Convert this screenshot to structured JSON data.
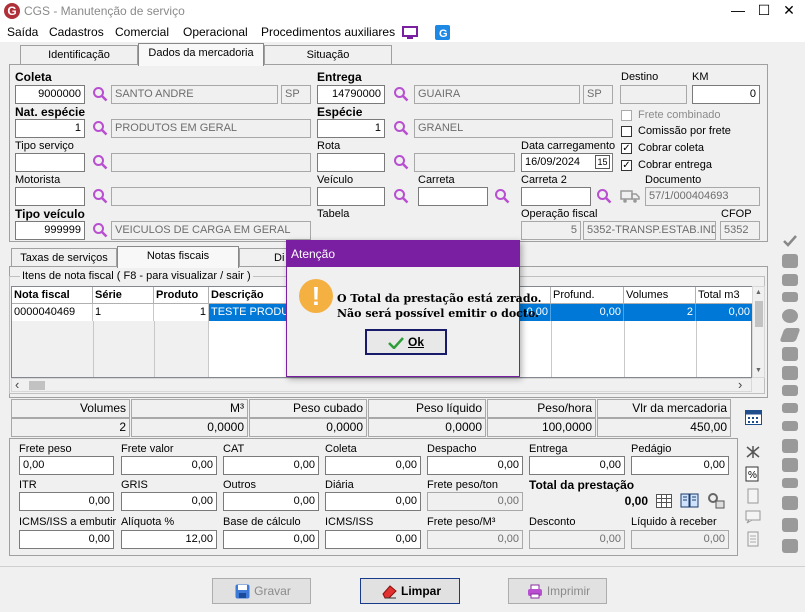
{
  "window": {
    "title": "CGS - Manutenção de serviço",
    "logo": "G",
    "minimize": "—",
    "maximize": "☐",
    "close": "✕"
  },
  "menu": [
    "Saída",
    "Cadastros",
    "Comercial",
    "Operacional",
    "Procedimentos auxiliares"
  ],
  "tabs": [
    "Identificação",
    "Dados da mercadoria",
    "Situação"
  ],
  "form": {
    "coleta": {
      "label": "Coleta",
      "code": "9000000",
      "name": "SANTO ANDRE",
      "uf": "SP"
    },
    "entrega": {
      "label": "Entrega",
      "code": "14790000",
      "name": "GUAIRA",
      "uf": "SP"
    },
    "destino": {
      "label": "Destino",
      "value": ""
    },
    "km": {
      "label": "KM",
      "value": "0"
    },
    "nat_especie": {
      "label": "Nat. espécie",
      "code": "1",
      "name": "PRODUTOS EM GERAL"
    },
    "especie": {
      "label": "Espécie",
      "code": "1",
      "name": "GRANEL"
    },
    "tipo_servico": {
      "label": "Tipo serviço"
    },
    "rota": {
      "label": "Rota"
    },
    "data_carregamento": {
      "label": "Data carregamento",
      "value": "16/09/2024",
      "day": "15"
    },
    "motorista": {
      "label": "Motorista"
    },
    "veiculo": {
      "label": "Veículo"
    },
    "carreta": {
      "label": "Carreta"
    },
    "carreta2": {
      "label": "Carreta 2"
    },
    "documento": {
      "label": "Documento",
      "value": "57/1/000404693"
    },
    "tipo_veiculo": {
      "label": "Tipo veículo",
      "code": "999999",
      "name": "VEICULOS DE CARGA EM GERAL"
    },
    "tabela": {
      "label": "Tabela"
    },
    "operacao_fiscal": {
      "label": "Operação fiscal",
      "code": "5",
      "name": "5352-TRANSP.ESTAB.IND"
    },
    "cfop": {
      "label": "CFOP",
      "value": "5352"
    },
    "checks": [
      {
        "label": "Frete combinado",
        "checked": false,
        "disabled": true
      },
      {
        "label": "Comissão por frete",
        "checked": false,
        "disabled": false
      },
      {
        "label": "Cobrar coleta",
        "checked": true,
        "disabled": false
      },
      {
        "label": "Cobrar entrega",
        "checked": true,
        "disabled": false
      }
    ]
  },
  "subtabs": [
    "Taxas de serviços",
    "Notas fiscais",
    "Di"
  ],
  "grid": {
    "title": "Itens de nota fiscal ( F8 - para visualizar / sair )",
    "headers_left": [
      "Nota fiscal",
      "Série",
      "Produto",
      "Descrição"
    ],
    "headers_right": [
      "Profund.",
      "Volumes",
      "Total m3"
    ],
    "row": {
      "nota": "0000040469",
      "serie": "1",
      "produto": "1",
      "descricao": "TESTE PRODU",
      "c1": "0,00",
      "profund": "0,00",
      "volumes": "2",
      "total_m3": "0,00"
    },
    "scroll_left": "‹",
    "scroll_right": "›",
    "scroll_up": "▲",
    "scroll_down": "▼"
  },
  "totals": {
    "labels": [
      "Volumes",
      "M³",
      "Peso cubado",
      "Peso líquido",
      "Peso/hora",
      "Vlr da mercadoria"
    ],
    "values": [
      "2",
      "0,0000",
      "0,0000",
      "0,0000",
      "100,0000",
      "450,00"
    ]
  },
  "freight": {
    "row1": [
      {
        "label": "Frete peso",
        "value": "0,00"
      },
      {
        "label": "Frete valor",
        "value": "0,00"
      },
      {
        "label": "CAT",
        "value": "0,00"
      },
      {
        "label": "Coleta",
        "value": "0,00"
      },
      {
        "label": "Despacho",
        "value": "0,00"
      },
      {
        "label": "Entrega",
        "value": "0,00"
      },
      {
        "label": "Pedágio",
        "value": "0,00"
      }
    ],
    "row2": [
      {
        "label": "ITR",
        "value": "0,00"
      },
      {
        "label": "GRIS",
        "value": "0,00"
      },
      {
        "label": "Outros",
        "value": "0,00"
      },
      {
        "label": "Diária",
        "value": "0,00"
      },
      {
        "label": "Frete peso/ton",
        "value": "0,00"
      }
    ],
    "total_label": "Total da prestação",
    "total_value": "0,00",
    "row3": [
      {
        "label": "ICMS/ISS a embutir",
        "value": "0,00"
      },
      {
        "label": "Alíquota %",
        "value": "12,00"
      },
      {
        "label": "Base de cálculo",
        "value": "0,00"
      },
      {
        "label": "ICMS/ISS",
        "value": "0,00"
      },
      {
        "label": "Frete peso/M³",
        "value": "0,00"
      },
      {
        "label": "Desconto",
        "value": "0,00"
      },
      {
        "label": "Líquido à receber",
        "value": "0,00"
      }
    ]
  },
  "buttons": {
    "gravar": "Gravar",
    "limpar": "Limpar",
    "imprimir": "Imprimir"
  },
  "dialog": {
    "title": "Atenção",
    "icon": "!",
    "line1": "O Total da prestação está zerado.",
    "line2": "Não será possível emitir o docto.",
    "ok": "Ok"
  },
  "colors": {
    "dialog": "#7b1fa2",
    "selection": "#0078d7",
    "search_icon": "#b84fd0"
  }
}
